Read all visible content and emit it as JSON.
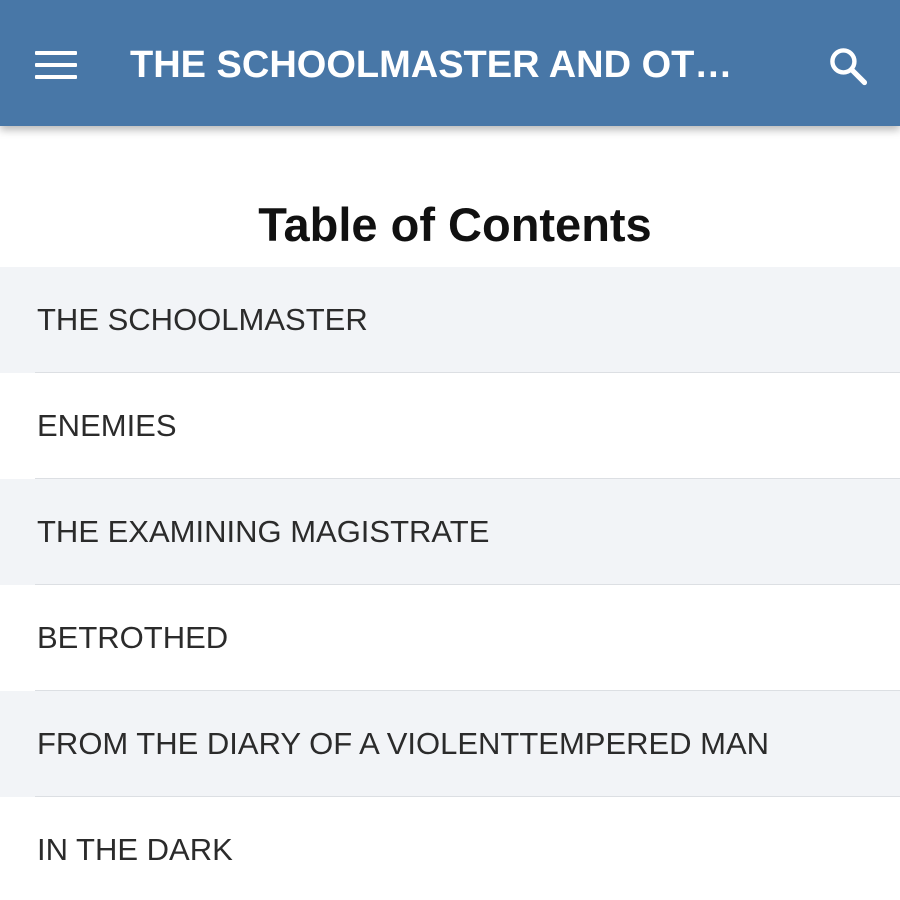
{
  "appbar": {
    "title": "THE SCHOOLMASTER AND OT…",
    "menu_icon": "menu-icon",
    "search_icon": "search-icon",
    "color": "#4877a7"
  },
  "toc": {
    "heading": "Table of Contents",
    "items": [
      "THE SCHOOLMASTER",
      "ENEMIES",
      "THE EXAMINING MAGISTRATE",
      "BETROTHED",
      "FROM THE DIARY OF A VIOLENTTEMPERED MAN",
      "IN THE DARK"
    ]
  }
}
